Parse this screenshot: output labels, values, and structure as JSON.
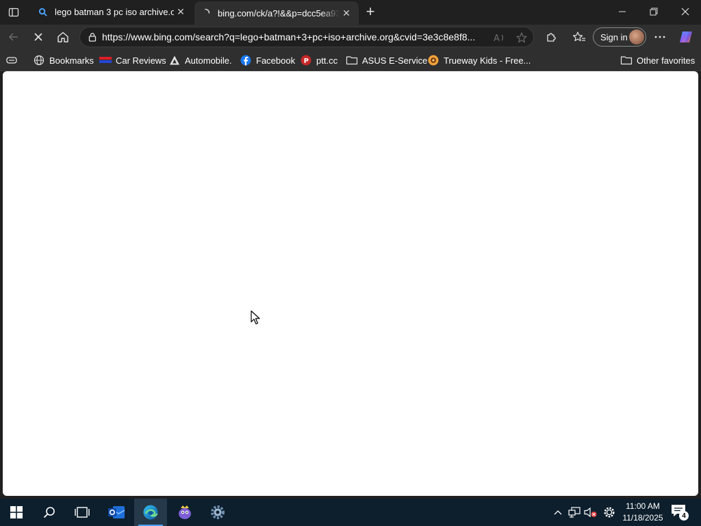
{
  "tabs": [
    {
      "title": "lego batman 3 pc iso archive.org",
      "close": "✕"
    },
    {
      "title": "bing.com/ck/a?!&&p=dcc5ea93a",
      "close": "✕"
    }
  ],
  "new_tab": "+",
  "address": {
    "url": "https://www.bing.com/search?q=lego+batman+3+pc+iso+archive.org&cvid=3e3c8e8f8..."
  },
  "profile": {
    "sign_in": "Sign in"
  },
  "bookmarks_bar": {
    "items": [
      {
        "label": "Bookmarks"
      },
      {
        "label": "Car Reviews"
      },
      {
        "label": "Automobile."
      },
      {
        "label": "Facebook"
      },
      {
        "label": "ptt.cc"
      },
      {
        "label": "ASUS E-Service"
      },
      {
        "label": "Trueway Kids - Free..."
      }
    ],
    "other": "Other favorites"
  },
  "taskbar": {
    "time": "11:00 AM",
    "date": "11/18/2025",
    "notifications": "4"
  },
  "colors": {
    "accent": "#4aa3ff",
    "taskbar": "#0d1f2d",
    "chrome": "#2f2f2f"
  }
}
